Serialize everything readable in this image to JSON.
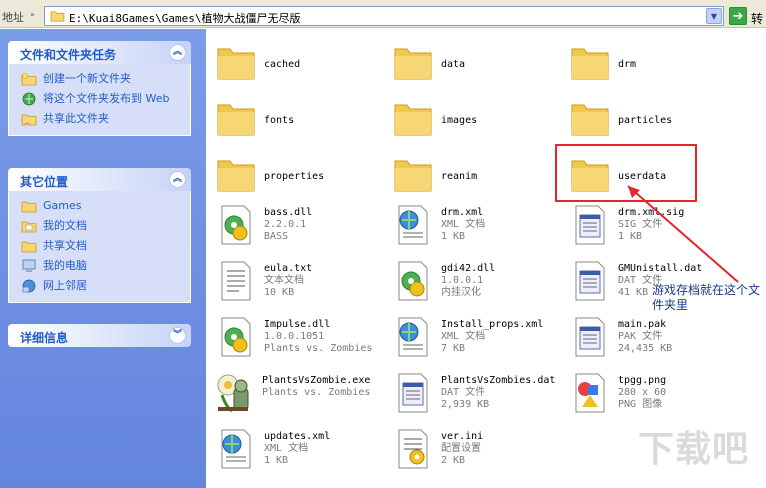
{
  "address_bar": {
    "label": "地址",
    "path": "E:\\Kuai8Games\\Games\\植物大战僵尸无尽版",
    "go_label": "转"
  },
  "task_pane": {
    "file_tasks": {
      "title": "文件和文件夹任务",
      "items": [
        "创建一个新文件夹",
        "将这个文件夹发布到 Web",
        "共享此文件夹"
      ]
    },
    "other_places": {
      "title": "其它位置",
      "items": [
        "Games",
        "我的文档",
        "共享文档",
        "我的电脑",
        "网上邻居"
      ]
    },
    "details": {
      "title": "详细信息"
    }
  },
  "folders": [
    "cached",
    "data",
    "drm",
    "fonts",
    "images",
    "particles",
    "properties",
    "reanim",
    "userdata"
  ],
  "files": [
    {
      "name": "bass.dll",
      "line2": "2.2.0.1",
      "line3": "BASS",
      "icon": "dll-gear-icon"
    },
    {
      "name": "drm.xml",
      "line2": "XML 文档",
      "line3": "1 KB",
      "icon": "xml-globe-icon"
    },
    {
      "name": "drm.xml.sig",
      "line2": "SIG 文件",
      "line3": "1 KB",
      "icon": "generic-file-icon"
    },
    {
      "name": "eula.txt",
      "line2": "文本文档",
      "line3": "10 KB",
      "icon": "text-file-icon"
    },
    {
      "name": "gdi42.dll",
      "line2": "1.0.0.1",
      "line3": "内挂汉化",
      "icon": "dll-gear-icon"
    },
    {
      "name": "GMUnistall.dat",
      "line2": "DAT 文件",
      "line3": "41 KB",
      "icon": "generic-file-icon"
    },
    {
      "name": "Impulse.dll",
      "line2": "1.0.0.1051",
      "line3": "Plants vs. Zombies",
      "icon": "dll-gear-icon"
    },
    {
      "name": "Install_props.xml",
      "line2": "XML 文档",
      "line3": "7 KB",
      "icon": "xml-globe-icon"
    },
    {
      "name": "main.pak",
      "line2": "PAK 文件",
      "line3": "24,435 KB",
      "icon": "generic-file-icon"
    },
    {
      "name": "PlantsVsZombie.exe",
      "line2": "Plants vs. Zombies",
      "line3": "",
      "icon": "zombie-exe-icon"
    },
    {
      "name": "PlantsVsZombies.dat",
      "line2": "DAT 文件",
      "line3": "2,939 KB",
      "icon": "generic-file-icon"
    },
    {
      "name": "tpgg.png",
      "line2": "280 x 60",
      "line3": "PNG 图像",
      "icon": "png-image-icon"
    },
    {
      "name": "updates.xml",
      "line2": "XML 文档",
      "line3": "1 KB",
      "icon": "xml-globe-icon"
    },
    {
      "name": "ver.ini",
      "line2": "配置设置",
      "line3": "2 KB",
      "icon": "ini-config-icon"
    }
  ],
  "annotation": "游戏存档就在这个文件夹里",
  "watermark": "下载吧",
  "colors": {
    "taskpane_bg": "#7b9ce9",
    "panel_title": "#215dc6",
    "highlight": "#e8232d",
    "annotation_text": "#1b3a8c",
    "folder_yellow": "#f7d774"
  }
}
